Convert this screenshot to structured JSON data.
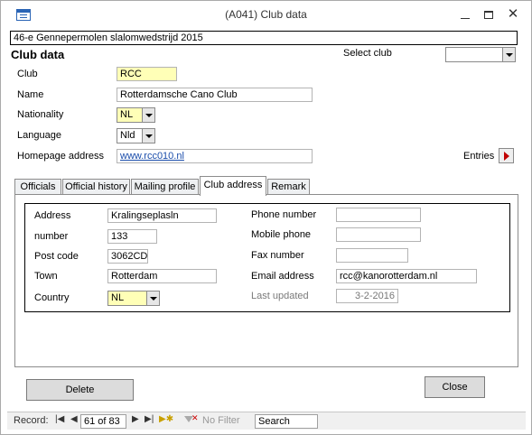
{
  "window": {
    "title": "(A041) Club data"
  },
  "header": {
    "event_title": "46-e Gennepermolen slalomwedstrijd 2015",
    "section_title": "Club data",
    "select_club_label": "Select club",
    "select_club_value": ""
  },
  "club": {
    "club_label": "Club",
    "club_value": "RCC",
    "name_label": "Name",
    "name_value": "Rotterdamsche Cano Club",
    "nationality_label": "Nationality",
    "nationality_value": "NL",
    "language_label": "Language",
    "language_value": "Nld",
    "homepage_label": "Homepage address",
    "homepage_value": "www.rcc010.nl",
    "entries_label": "Entries"
  },
  "tabs": [
    {
      "label": "Officials"
    },
    {
      "label": "Official history"
    },
    {
      "label": "Mailing profile"
    },
    {
      "label": "Club address"
    },
    {
      "label": "Remark"
    }
  ],
  "active_tab": "Club address",
  "address": {
    "address_label": "Address",
    "address_value": "Kralingseplasln",
    "number_label": "number",
    "number_value": "133",
    "postcode_label": "Post code",
    "postcode_value": "3062CD",
    "town_label": "Town",
    "town_value": "Rotterdam",
    "country_label": "Country",
    "country_value": "NL",
    "phone_label": "Phone number",
    "phone_value": "",
    "mobile_label": "Mobile phone",
    "mobile_value": "",
    "fax_label": "Fax number",
    "fax_value": "",
    "email_label": "Email address",
    "email_value": "rcc@kanorotterdam.nl",
    "updated_label": "Last updated",
    "updated_value": "3-2-2016"
  },
  "buttons": {
    "delete": "Delete",
    "close": "Close"
  },
  "navigation": {
    "record_label": "Record:",
    "record_position": "61 of 83",
    "no_filter": "No Filter",
    "search": "Search"
  },
  "colors": {
    "required_field": "#ffffb7",
    "link": "#1a4dab",
    "entries_arrow": "#c00000"
  }
}
